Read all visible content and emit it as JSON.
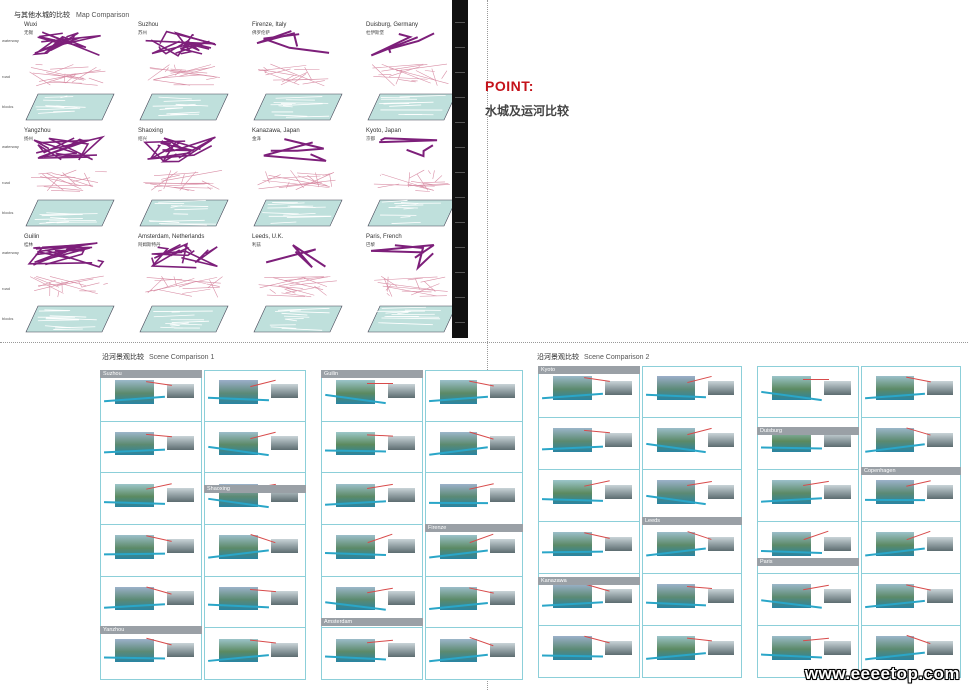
{
  "map_section": {
    "title_cn": "与其他水城的比较",
    "title_en": "Map Comparison",
    "row_labels": [
      {
        "en": "waterway",
        "cn": "水系"
      },
      {
        "en": "road",
        "cn": "道路"
      },
      {
        "en": "blocks",
        "cn": "街区"
      }
    ],
    "cities": [
      {
        "en": "Wuxi",
        "cn": "无锡"
      },
      {
        "en": "Suzhou",
        "cn": "苏州"
      },
      {
        "en": "Firenze, Italy",
        "cn": "佛罗伦萨"
      },
      {
        "en": "Duisburg, Germany",
        "cn": "杜伊斯堡"
      },
      {
        "en": "Yangzhou",
        "cn": "扬州"
      },
      {
        "en": "Shaoxing",
        "cn": "绍兴"
      },
      {
        "en": "Kanazawa, Japan",
        "cn": "金泽"
      },
      {
        "en": "Kyoto, Japan",
        "cn": "京都"
      },
      {
        "en": "Guilin",
        "cn": "桂林"
      },
      {
        "en": "Amsterdam, Netherlands",
        "cn": "阿姆斯特丹"
      },
      {
        "en": "Leeds, U.K.",
        "cn": "利兹"
      },
      {
        "en": "Paris, French",
        "cn": "巴黎"
      }
    ]
  },
  "point": {
    "title": "POINT:",
    "subtitle": "水城及运河比较"
  },
  "scene1": {
    "title_cn": "沿河景观比较",
    "title_en": "Scene Comparison 1",
    "headers": [
      "Suzhou",
      "Shaoxing",
      "Yanzhou",
      "Guilin",
      "Firenze",
      "Amsterdam"
    ]
  },
  "scene2": {
    "title_cn": "沿河景观比较",
    "title_en": "Scene Comparison 2",
    "headers": [
      "Kyoto",
      "Kanazawa",
      "Leeds",
      "Duisburg",
      "Copenhagen",
      "Paris"
    ]
  },
  "watermark": "www.eeeetop.com"
}
